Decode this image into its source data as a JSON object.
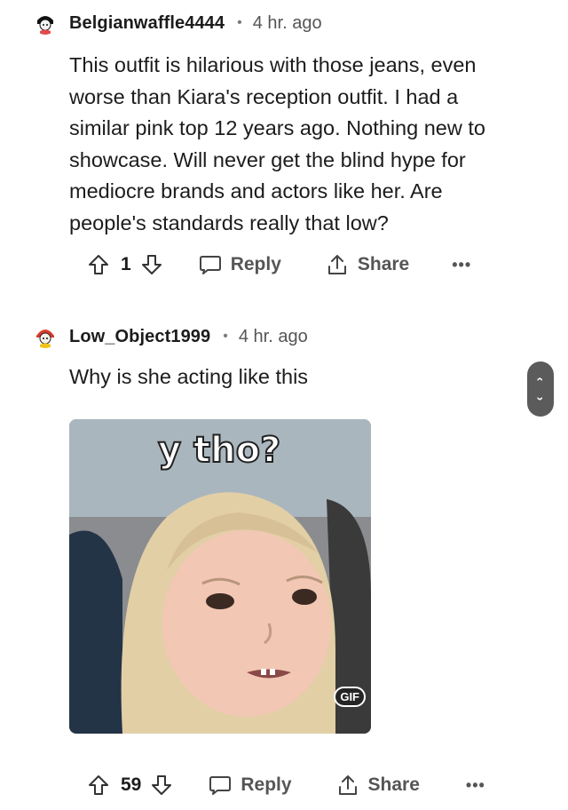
{
  "comments": [
    {
      "username": "Belgianwaffle4444",
      "separator": "•",
      "time": "4 hr. ago",
      "body": "This outfit is hilarious with those jeans, even\nworse than Kiara's reception outfit. I had a\nsimilar pink top 12 years ago. Nothing new to\nshowcase. Will never get the blind hype for\nmediocre brands and actors like her. Are\npeople's standards really that low?",
      "score": "1",
      "reply_label": "Reply",
      "share_label": "Share",
      "more_label": "•••"
    },
    {
      "username": "Low_Object1999",
      "separator": "•",
      "time": "4 hr. ago",
      "body": "Why is she acting like this",
      "gif": {
        "caption": "y tho?",
        "badge": "GIF"
      },
      "score": "59",
      "reply_label": "Reply",
      "share_label": "Share",
      "more_label": "•••"
    }
  ],
  "scroll_control": {
    "up": "‹",
    "down": "›"
  },
  "icons": {
    "upvote": "upvote-arrow-icon",
    "downvote": "downvote-arrow-icon",
    "reply": "speech-bubble-icon",
    "share": "share-arrow-icon"
  }
}
